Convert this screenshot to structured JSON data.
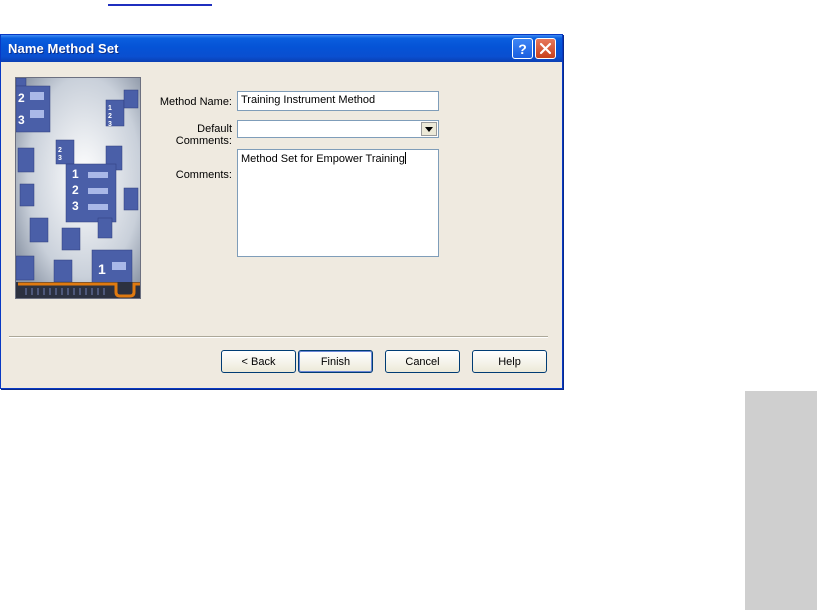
{
  "window": {
    "title": "Name Method Set"
  },
  "form": {
    "method_name_label": "Method Name:",
    "method_name_value": "Training Instrument Method",
    "default_comments_label": "Default Comments:",
    "default_comments_value": "",
    "comments_label": "Comments:",
    "comments_value": "Method Set for Empower Training"
  },
  "buttons": {
    "back": "< Back",
    "finish": "Finish",
    "cancel": "Cancel",
    "help": "Help"
  },
  "icons": [
    "help-icon",
    "close-icon",
    "dropdown-arrow-icon",
    "wizard-illustration"
  ],
  "colors": {
    "titlebar": "#0553d6",
    "dialog_bg": "#efeae0",
    "accent_orange": "#e07a10"
  }
}
